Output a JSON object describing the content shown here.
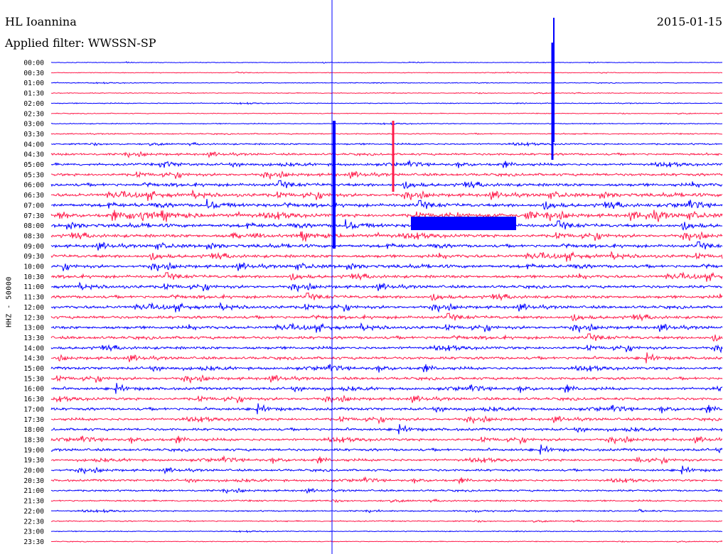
{
  "header": {
    "station": "HL Ioannina",
    "filter": "Applied filter: WWSSN-SP",
    "date": "2015-01-15"
  },
  "chart_data": {
    "type": "line",
    "title": "HL Ioannina",
    "subtitle": "Applied filter: WWSSN-SP",
    "date": "2015-01-15",
    "ylabel": "HHZ - 50000",
    "grid": false,
    "trace_colors": [
      "#0000ff",
      "#ff1a4a"
    ],
    "row_labels": [
      "00:00",
      "00:30",
      "01:00",
      "01:30",
      "02:00",
      "02:30",
      "03:00",
      "03:30",
      "04:00",
      "04:30",
      "05:00",
      "05:30",
      "06:00",
      "06:30",
      "07:00",
      "07:30",
      "08:00",
      "08:30",
      "09:00",
      "09:30",
      "10:00",
      "10:30",
      "11:00",
      "11:30",
      "12:00",
      "12:30",
      "13:00",
      "13:30",
      "14:00",
      "14:30",
      "15:00",
      "15:30",
      "16:00",
      "16:30",
      "17:00",
      "17:30",
      "18:00",
      "18:30",
      "19:00",
      "19:30",
      "20:00",
      "20:30",
      "21:00",
      "21:30",
      "22:00",
      "22:30",
      "23:00",
      "23:30"
    ],
    "noise_level": [
      0.25,
      0.25,
      0.3,
      0.3,
      0.35,
      0.3,
      0.35,
      0.45,
      0.6,
      0.8,
      0.9,
      1.0,
      1.1,
      1.15,
      1.2,
      1.25,
      1.2,
      1.15,
      1.1,
      1.1,
      1.1,
      1.05,
      1.05,
      1.05,
      1.05,
      1.05,
      1.05,
      1.05,
      1.0,
      1.0,
      1.0,
      1.0,
      1.0,
      1.0,
      1.0,
      0.95,
      0.95,
      0.95,
      0.95,
      0.9,
      0.85,
      0.8,
      0.7,
      0.6,
      0.5,
      0.45,
      0.35,
      0.3
    ]
  }
}
